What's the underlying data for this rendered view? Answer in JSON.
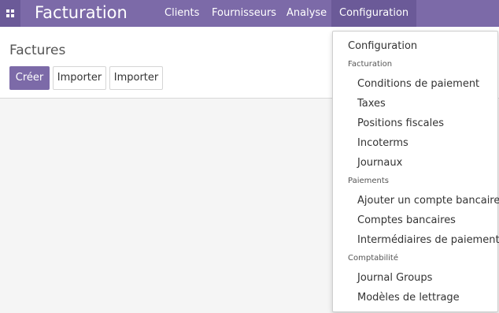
{
  "topbar": {
    "brand": "Facturation",
    "menu": [
      "Clients",
      "Fournisseurs",
      "Analyse",
      "Configuration"
    ]
  },
  "control_panel": {
    "title": "Factures",
    "buttons": [
      "Créer",
      "Importer",
      "Importer"
    ]
  },
  "dropdown": {
    "title": "Configuration",
    "sections": [
      {
        "header": "Facturation",
        "items": [
          "Conditions de paiement",
          "Taxes",
          "Positions fiscales",
          "Incoterms",
          "Journaux"
        ]
      },
      {
        "header": "Paiements",
        "items": [
          "Ajouter un compte bancaire",
          "Comptes bancaires",
          "Intermédiaires de paiement"
        ]
      },
      {
        "header": "Comptabilité",
        "items": [
          "Journal Groups",
          "Modèles de lettrage"
        ]
      }
    ]
  },
  "colors": {
    "brand": "#7c6aa8",
    "brand_dark": "#6b5a98"
  }
}
